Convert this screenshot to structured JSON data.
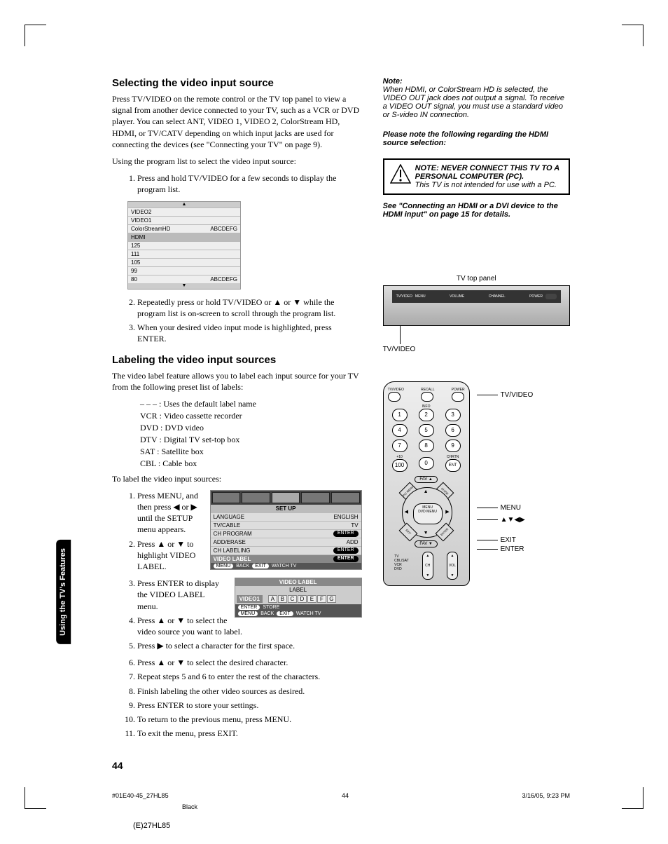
{
  "headings": {
    "h1": "Selecting the video input source",
    "h2": "Labeling the video input sources"
  },
  "p1": "Press TV/VIDEO on the remote control or the TV top panel to view a signal from another device connected to your TV, such as a VCR or DVD player. You can select ANT, VIDEO 1, VIDEO 2, ColorStream HD, HDMI, or TV/CATV depending on which input jacks are used for connecting the devices (see \"Connecting your TV\" on page 9).",
  "p2": "Using the program list to select the video input source:",
  "steps1": [
    "Press and hold TV/VIDEO for a few seconds to display the program list.",
    "Repeatedly press or hold TV/VIDEO or ▲ or ▼ while the program list is on-screen to scroll through the program list.",
    "When your desired video input mode is highlighted, press ENTER."
  ],
  "proglist": {
    "rows": [
      {
        "l": "VIDEO2",
        "r": ""
      },
      {
        "l": "VIDEO1",
        "r": ""
      },
      {
        "l": "ColorStreamHD",
        "r": "ABCDEFG"
      },
      {
        "l": "HDMI",
        "r": ""
      },
      {
        "l": "125",
        "r": ""
      },
      {
        "l": "111",
        "r": ""
      },
      {
        "l": "105",
        "r": ""
      },
      {
        "l": "99",
        "r": ""
      },
      {
        "l": "80",
        "r": "ABCDEFG"
      }
    ]
  },
  "p3": "The video label feature allows you to label each input source for your TV from the following preset list of labels:",
  "labels": {
    "dash": "– – –  : Uses the default label name",
    "vcr": "VCR  : Video cassette recorder",
    "dvd": "DVD  : DVD video",
    "dtv": "DTV  : Digital TV set-top box",
    "sat": "SAT   : Satellite box",
    "cbl": "CBL   : Cable box"
  },
  "p4": "To label the video input sources:",
  "steps2": [
    "Press MENU, and then press ◀ or ▶ until the SETUP menu appears.",
    "Press ▲ or ▼ to highlight VIDEO LABEL.",
    "Press ENTER to display the VIDEO LABEL menu.",
    "Press ▲ or ▼ to select the video source you want to label.",
    "Press ▶ to select a character for the first space.",
    "Press ▲ or ▼ to select the desired character.",
    "Repeat steps 5 and 6 to enter the rest of the characters.",
    "Finish labeling the other video sources as desired.",
    "Press ENTER to store your settings.",
    "To return to the previous menu, press MENU.",
    "To exit the menu, press EXIT."
  ],
  "setupmenu": {
    "title": "SET UP",
    "rows": [
      {
        "l": "LANGUAGE",
        "r": "ENGLISH",
        "pill": false
      },
      {
        "l": "TV/CABLE",
        "r": "TV",
        "pill": false
      },
      {
        "l": "CH PROGRAM",
        "r": "ENTER",
        "pill": true
      },
      {
        "l": "ADD/ERASE",
        "r": "ADD",
        "pill": false
      },
      {
        "l": "CH LABELING",
        "r": "ENTER",
        "pill": true
      },
      {
        "l": "VIDEO LABEL",
        "r": "ENTER",
        "pill": true,
        "hi": true
      }
    ],
    "foot": {
      "b1": "MENU",
      "t1": "BACK",
      "b2": "EXIT",
      "t2": "WATCH TV"
    }
  },
  "labelmenu": {
    "title": "VIDEO LABEL",
    "sub": "LABEL",
    "sel": "VIDEO1",
    "chars": [
      "A",
      "B",
      "C",
      "D",
      "E",
      "F",
      "G"
    ],
    "foot": {
      "b1": "ENTER",
      "t1": "STORE",
      "b2": "MENU",
      "t2": "BACK",
      "b3": "EXIT",
      "t3": "WATCH TV"
    }
  },
  "right": {
    "note_hd": "Note:",
    "note_body": "When HDMI, or ColorStream HD is selected, the VIDEO OUT jack does not output a signal. To receive a VIDEO OUT signal, you must use a standard video or S-video IN connection.",
    "please": "Please note the following regarding the HDMI source selection:",
    "warn_bold": "NOTE: NEVER CONNECT THIS TV TO A PERSONAL COMPUTER (PC).",
    "warn_it": "This TV is not intended for use with a PC.",
    "see": "See \"Connecting an HDMI or a DVI device to the HDMI input\" on page 15 for details.",
    "toppanel_cap": "TV top panel",
    "toppanel_lbl": "TV/VIDEO",
    "panel_labels": {
      "tvv": "TV/VIDEO",
      "menu": "MENU",
      "vol": "VOLUME",
      "ch": "CHANNEL",
      "pow": "POWER"
    }
  },
  "callouts": {
    "tvvideo": "TV/VIDEO",
    "menu": "MENU",
    "arrows": "▲▼◀▶",
    "exit": "EXIT",
    "enter": "ENTER"
  },
  "remote": {
    "top": {
      "l": "TV/VIDEO",
      "m": "RECALL",
      "r": "POWER"
    },
    "info": "INFO",
    "below10": "+10",
    "belowEnt": "CHRTN",
    "fav1": "FAV ▲",
    "fav2": "FAV ▼",
    "corners": {
      "c1": "PIC MENU",
      "c2": "GUIDE",
      "c3": "EXIT",
      "c4": "ENTER"
    },
    "menu": "MENU",
    "dvd": "DVD MENU",
    "ch": "CH",
    "vol": "VOL",
    "modes": "TV\nCBL/SAT\nVCR\nDVD"
  },
  "sidetab": "Using the TV's\nFeatures",
  "pgnum": "44",
  "footer": {
    "l": "#01E40-45_27HL85",
    "m": "44",
    "r": "3/16/05, 9:23 PM"
  },
  "footer2": "Black",
  "footer3": "(E)27HL85"
}
